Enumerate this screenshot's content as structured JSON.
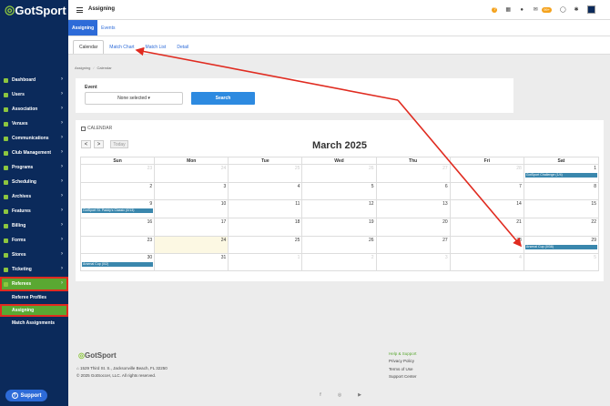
{
  "brand": {
    "logo_text": "GotSport",
    "accent": "#5aa832",
    "primary": "#0b2a5b",
    "link": "#2d6bd8",
    "annotation": "#e02b20"
  },
  "topbar": {
    "title": "Assigning",
    "notif_badge": "99+"
  },
  "sidebar": {
    "items": [
      {
        "label": "Dashboard",
        "icon": "dashboard-icon"
      },
      {
        "label": "Users",
        "icon": "users-icon"
      },
      {
        "label": "Association",
        "icon": "association-icon"
      },
      {
        "label": "Venues",
        "icon": "venues-icon"
      },
      {
        "label": "Communications",
        "icon": "communications-icon"
      },
      {
        "label": "Club Management",
        "icon": "club-management-icon"
      },
      {
        "label": "Programs",
        "icon": "programs-icon"
      },
      {
        "label": "Scheduling",
        "icon": "scheduling-icon"
      },
      {
        "label": "Archives",
        "icon": "archives-icon"
      },
      {
        "label": "Features",
        "icon": "features-icon"
      },
      {
        "label": "Billing",
        "icon": "billing-icon"
      },
      {
        "label": "Forms",
        "icon": "forms-icon"
      },
      {
        "label": "Stores",
        "icon": "stores-icon"
      },
      {
        "label": "Ticketing",
        "icon": "ticketing-icon"
      },
      {
        "label": "Referees",
        "icon": "referees-icon"
      }
    ],
    "sub_items": [
      {
        "label": "Referee Profiles"
      },
      {
        "label": "Assigning"
      },
      {
        "label": "Match Assignments"
      }
    ],
    "support_label": "Support"
  },
  "main_tabs": [
    "Assigning",
    "Events"
  ],
  "sub_tabs": [
    "Calendar",
    "Match Chart",
    "Match List",
    "Detail"
  ],
  "breadcrumb": [
    "Assigning",
    "Calendar"
  ],
  "event_filter": {
    "label": "Event",
    "select_value": "None selected",
    "search_label": "Search"
  },
  "calendar": {
    "header": "CALENDAR",
    "today_label": "Today",
    "prev": "<",
    "next": ">",
    "month_title": "March 2025",
    "weekdays": [
      "Sun",
      "Mon",
      "Tue",
      "Wed",
      "Thu",
      "Fri",
      "Sat"
    ],
    "weeks": [
      [
        {
          "n": "23",
          "o": true
        },
        {
          "n": "24",
          "o": true
        },
        {
          "n": "25",
          "o": true
        },
        {
          "n": "26",
          "o": true
        },
        {
          "n": "27",
          "o": true
        },
        {
          "n": "28",
          "o": true
        },
        {
          "n": "1",
          "e": "GotSport Challenge (1/4)"
        }
      ],
      [
        {
          "n": "2"
        },
        {
          "n": "3"
        },
        {
          "n": "4"
        },
        {
          "n": "5"
        },
        {
          "n": "6"
        },
        {
          "n": "7"
        },
        {
          "n": "8"
        }
      ],
      [
        {
          "n": "9",
          "e": "GotSport St. Paddy's Classic (0/13)"
        },
        {
          "n": "10"
        },
        {
          "n": "11"
        },
        {
          "n": "12"
        },
        {
          "n": "13"
        },
        {
          "n": "14"
        },
        {
          "n": "15"
        }
      ],
      [
        {
          "n": "16"
        },
        {
          "n": "17"
        },
        {
          "n": "18"
        },
        {
          "n": "19"
        },
        {
          "n": "20"
        },
        {
          "n": "21"
        },
        {
          "n": "22"
        }
      ],
      [
        {
          "n": "23"
        },
        {
          "n": "24",
          "t": true
        },
        {
          "n": "25"
        },
        {
          "n": "26"
        },
        {
          "n": "27"
        },
        {
          "n": "28"
        },
        {
          "n": "29",
          "e": "Arsenal Cup (0/38)"
        }
      ],
      [
        {
          "n": "30",
          "e": "Arsenal Cup (0/2)"
        },
        {
          "n": "31"
        },
        {
          "n": "1",
          "o": true
        },
        {
          "n": "2",
          "o": true
        },
        {
          "n": "3",
          "o": true
        },
        {
          "n": "4",
          "o": true
        },
        {
          "n": "5",
          "o": true
        }
      ]
    ]
  },
  "footer": {
    "address": "1529 Third St. S., Jacksonville Beach, FL 32250",
    "copyright": "© 2025 GotSoccer, LLC. All rights reserved.",
    "links": [
      "Help & Support",
      "Privacy Policy",
      "Terms of Use",
      "Support Center"
    ]
  }
}
